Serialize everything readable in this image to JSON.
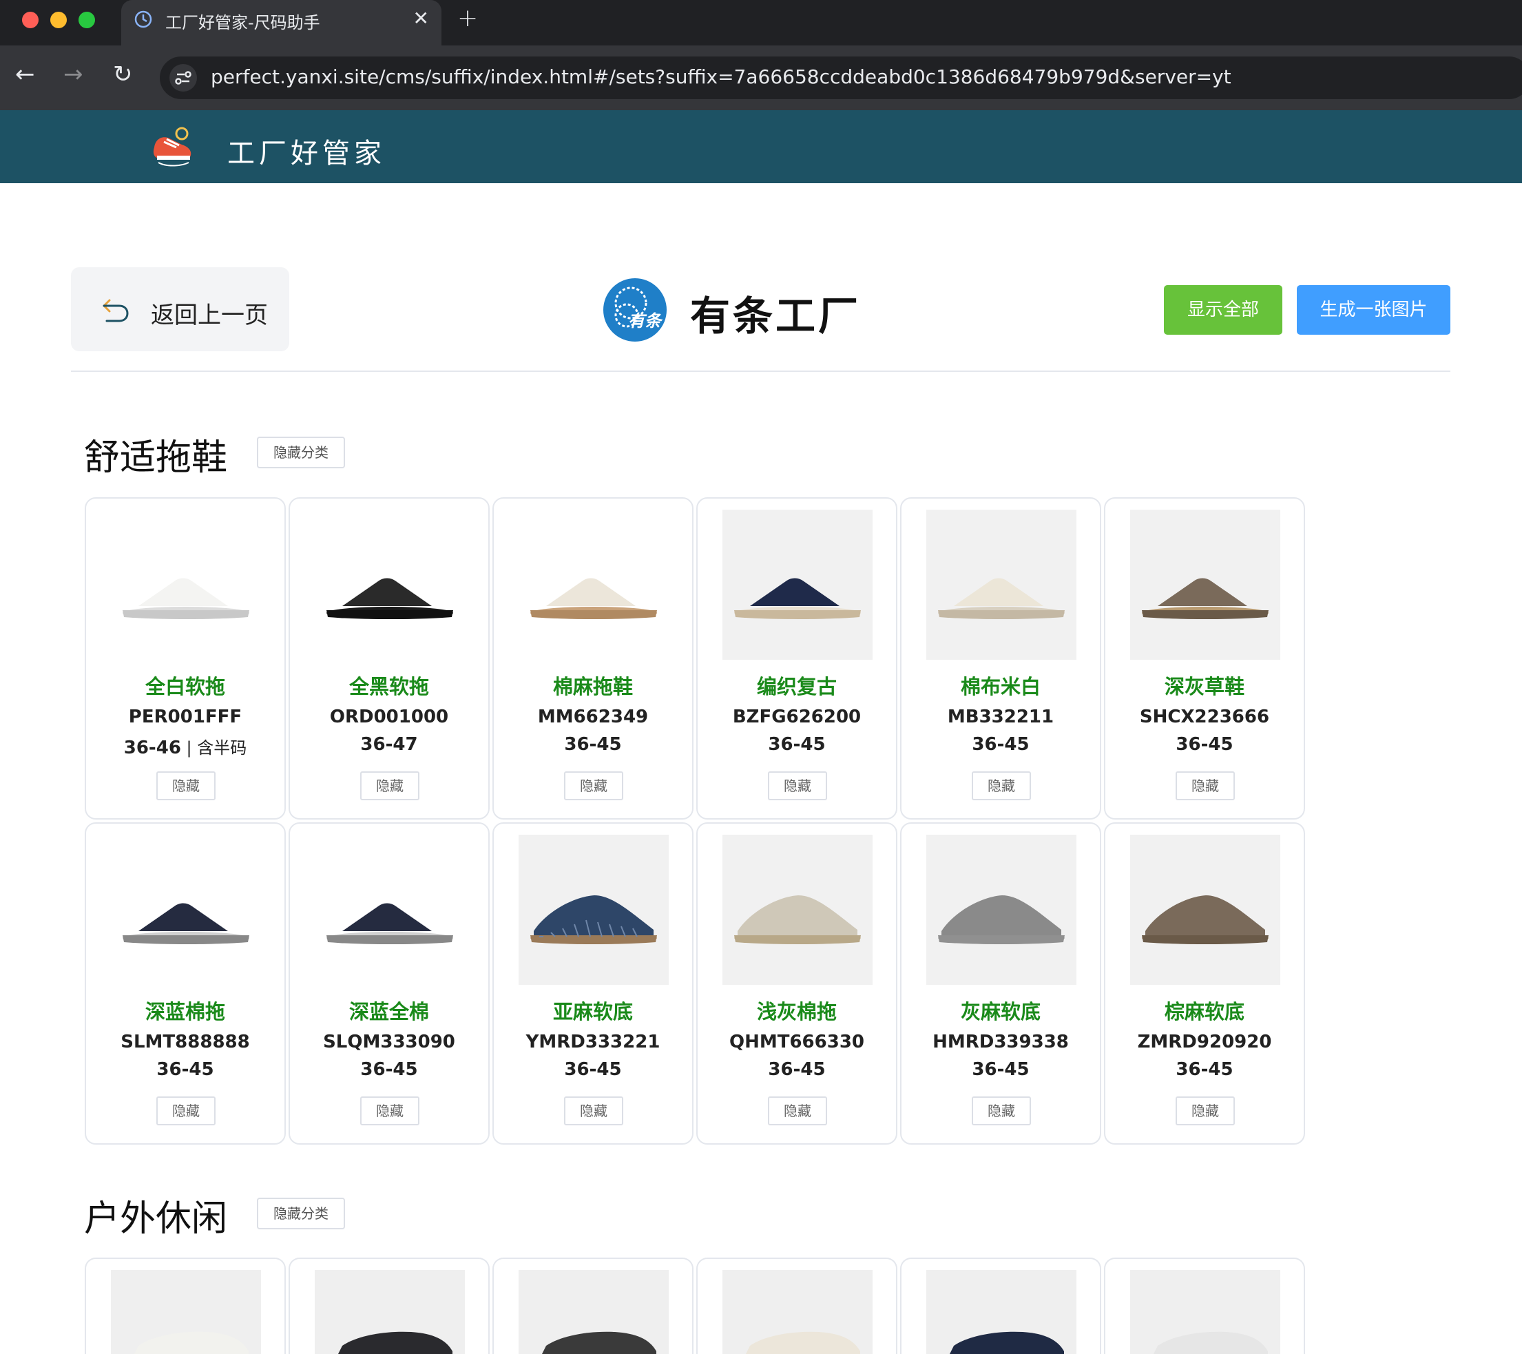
{
  "browser": {
    "tab_title": "工厂好管家-尺码助手",
    "tab_close": "✕",
    "new_tab": "+",
    "url": "perfect.yanxi.site/cms/suffix/index.html#/sets?suffix=7a66658ccddeabd0c1386d68479b979d&server=yt",
    "nav_back": "←",
    "nav_forward": "→",
    "nav_reload": "↻"
  },
  "app": {
    "title": "工厂好管家"
  },
  "toolbar": {
    "back_label": "返回上一页",
    "factory_logo_text": "有条",
    "factory_name": "有条工厂",
    "show_all_label": "显示全部",
    "generate_image_label": "生成一张图片"
  },
  "colors": {
    "header_bg": "#1d5264",
    "name_green": "#1a8a1a",
    "show_all_green": "#67c23a",
    "generate_blue": "#409eff"
  },
  "categories": [
    {
      "title": "舒适拖鞋",
      "hide_label": "隐藏分类",
      "items": [
        {
          "name": "全白软拖",
          "code": "PER001FFF",
          "size": "36-46",
          "size_note": " | 含半码",
          "hide": "隐藏",
          "icon": "white-slide-icon"
        },
        {
          "name": "全黑软拖",
          "code": "ORD001000",
          "size": "36-47",
          "size_note": "",
          "hide": "隐藏",
          "icon": "black-slide-icon"
        },
        {
          "name": "棉麻拖鞋",
          "code": "MM662349",
          "size": "36-45",
          "size_note": "",
          "hide": "隐藏",
          "icon": "linen-slipper-icon"
        },
        {
          "name": "编织复古",
          "code": "BZFG626200",
          "size": "36-45",
          "size_note": "",
          "hide": "隐藏",
          "icon": "woven-slipper-icon"
        },
        {
          "name": "棉布米白",
          "code": "MB332211",
          "size": "36-45",
          "size_note": "",
          "hide": "隐藏",
          "icon": "beige-slipper-icon"
        },
        {
          "name": "深灰草鞋",
          "code": "SHCX223666",
          "size": "36-45",
          "size_note": "",
          "hide": "隐藏",
          "icon": "grey-straw-slipper-icon"
        },
        {
          "name": "深蓝棉拖",
          "code": "SLMT888888",
          "size": "36-45",
          "size_note": "",
          "hide": "隐藏",
          "icon": "navy-slipper-icon"
        },
        {
          "name": "深蓝全棉",
          "code": "SLQM333090",
          "size": "36-45",
          "size_note": "",
          "hide": "隐藏",
          "icon": "navy-cotton-slipper-icon"
        },
        {
          "name": "亚麻软底",
          "code": "YMRD333221",
          "size": "36-45",
          "size_note": "",
          "hide": "隐藏",
          "icon": "striped-slipper-icon"
        },
        {
          "name": "浅灰棉拖",
          "code": "QHMT666330",
          "size": "36-45",
          "size_note": "",
          "hide": "隐藏",
          "icon": "light-grey-slipper-icon"
        },
        {
          "name": "灰麻软底",
          "code": "HMRD339338",
          "size": "36-45",
          "size_note": "",
          "hide": "隐藏",
          "icon": "grey-linen-slipper-icon"
        },
        {
          "name": "棕麻软底",
          "code": "ZMRD920920",
          "size": "36-45",
          "size_note": "",
          "hide": "隐藏",
          "icon": "brown-linen-slipper-icon"
        }
      ]
    },
    {
      "title": "户外休闲",
      "hide_label": "隐藏分类",
      "items": [
        {
          "icon": "white-sneaker-icon"
        },
        {
          "icon": "black-sneaker-icon"
        },
        {
          "icon": "dark-grey-sneaker-icon"
        },
        {
          "icon": "cream-sneaker-icon"
        },
        {
          "icon": "navy-sneaker-icon"
        },
        {
          "icon": "light-sneaker-icon"
        }
      ]
    }
  ]
}
